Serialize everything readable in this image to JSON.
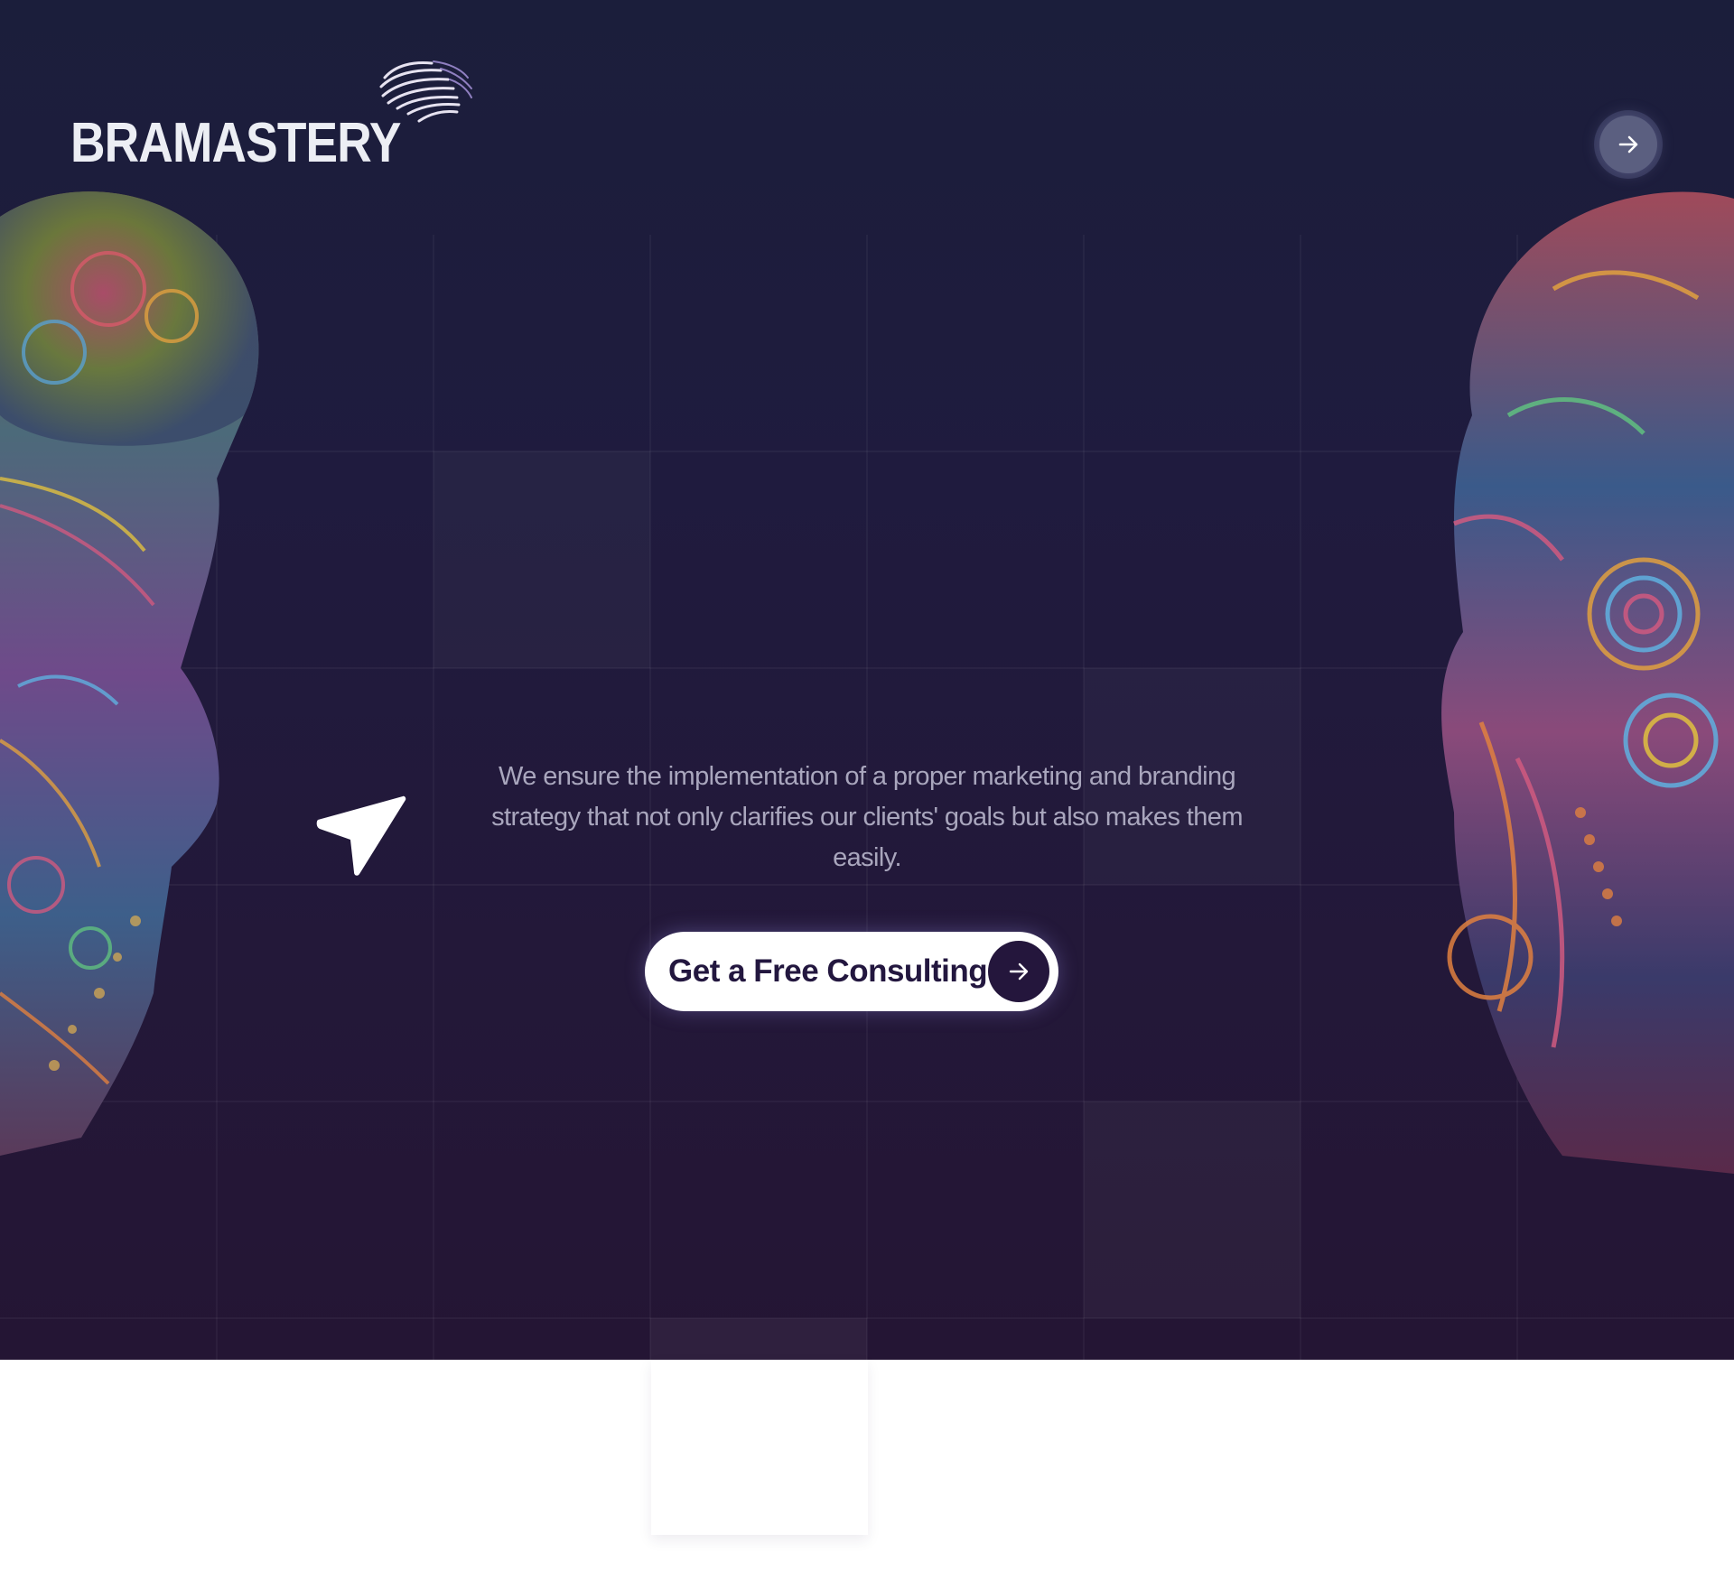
{
  "brand": {
    "name": "BRAMASTERY",
    "logo_icon": "brain-icon"
  },
  "header": {
    "action_icon": "arrow-right-icon"
  },
  "hero": {
    "decor_icon": "paper-plane-icon",
    "tagline": "We ensure the implementation of a proper marketing and branding strategy  that not only clarifies our clients' goals but also makes them easily.",
    "cta_label": "Get a Free Consulting",
    "cta_icon": "arrow-right-icon"
  },
  "colors": {
    "background": "#1f1b3e",
    "accent": "#24163c",
    "text": "#a9a6bd",
    "button": "#ffffff"
  }
}
